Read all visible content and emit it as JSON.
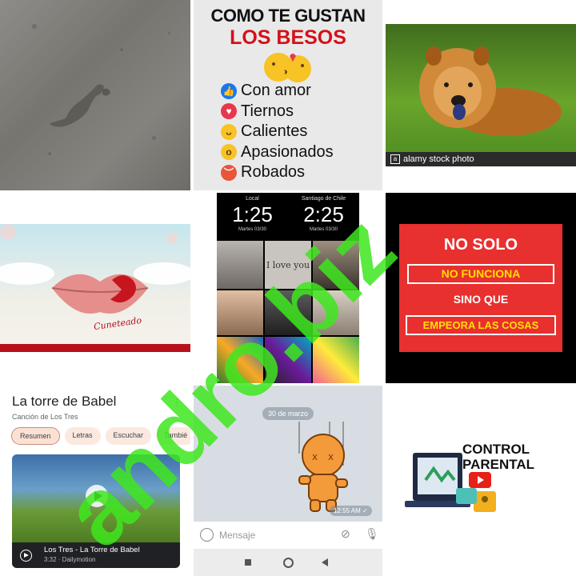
{
  "besos": {
    "line1": "COMO TE GUSTAN",
    "line2": "LOS BESOS",
    "items": [
      {
        "label": "Con amor",
        "icon": "like-icon",
        "color": "#1877f2"
      },
      {
        "label": "Tiernos",
        "icon": "heart-icon",
        "color": "#e8374d"
      },
      {
        "label": "Calientes",
        "icon": "laugh-icon",
        "color": "#f7c325"
      },
      {
        "label": "Apasionados",
        "icon": "wow-icon",
        "color": "#f7c325"
      },
      {
        "label": "Robados",
        "icon": "angry-icon",
        "color": "#e9553a"
      }
    ]
  },
  "dog": {
    "watermark": "alamy stock photo"
  },
  "lips": {
    "caption": "Cuneteado"
  },
  "collage": {
    "clock_left": {
      "city": "Local",
      "time": "1:25",
      "date": "Martes 03/30"
    },
    "clock_right": {
      "city": "Santiago de Chile",
      "time": "2:25",
      "date": "Martes 03/30"
    },
    "love_text": "I love you"
  },
  "nosolo": {
    "line1": "NO SOLO",
    "line2": "NO FUNCIONA",
    "line3": "SINO QUE",
    "line4": "EMPEORA LAS COSAS"
  },
  "youtube": {
    "title": "La torre de Babel",
    "subtitle": "Canción de Los Tres",
    "chips": [
      "Resumen",
      "Letras",
      "Escuchar",
      "Tambié"
    ],
    "video_title": "Los Tres - La Torre de Babel",
    "video_meta": "3:32 · Dailymotion"
  },
  "telegram": {
    "date_pill": "30 de marzo",
    "timestamp": "12:55 AM ✓",
    "placeholder": "Mensaje"
  },
  "parental": {
    "line1": "CONTROL",
    "line2": "PARENTAL"
  },
  "watermark_text": "andro.biz",
  "colors": {
    "besos_red": "#d3121a",
    "nosolo_bg": "#e8302f",
    "nosolo_highlight": "#ffe000",
    "watermark_green": "#3ee61f"
  }
}
